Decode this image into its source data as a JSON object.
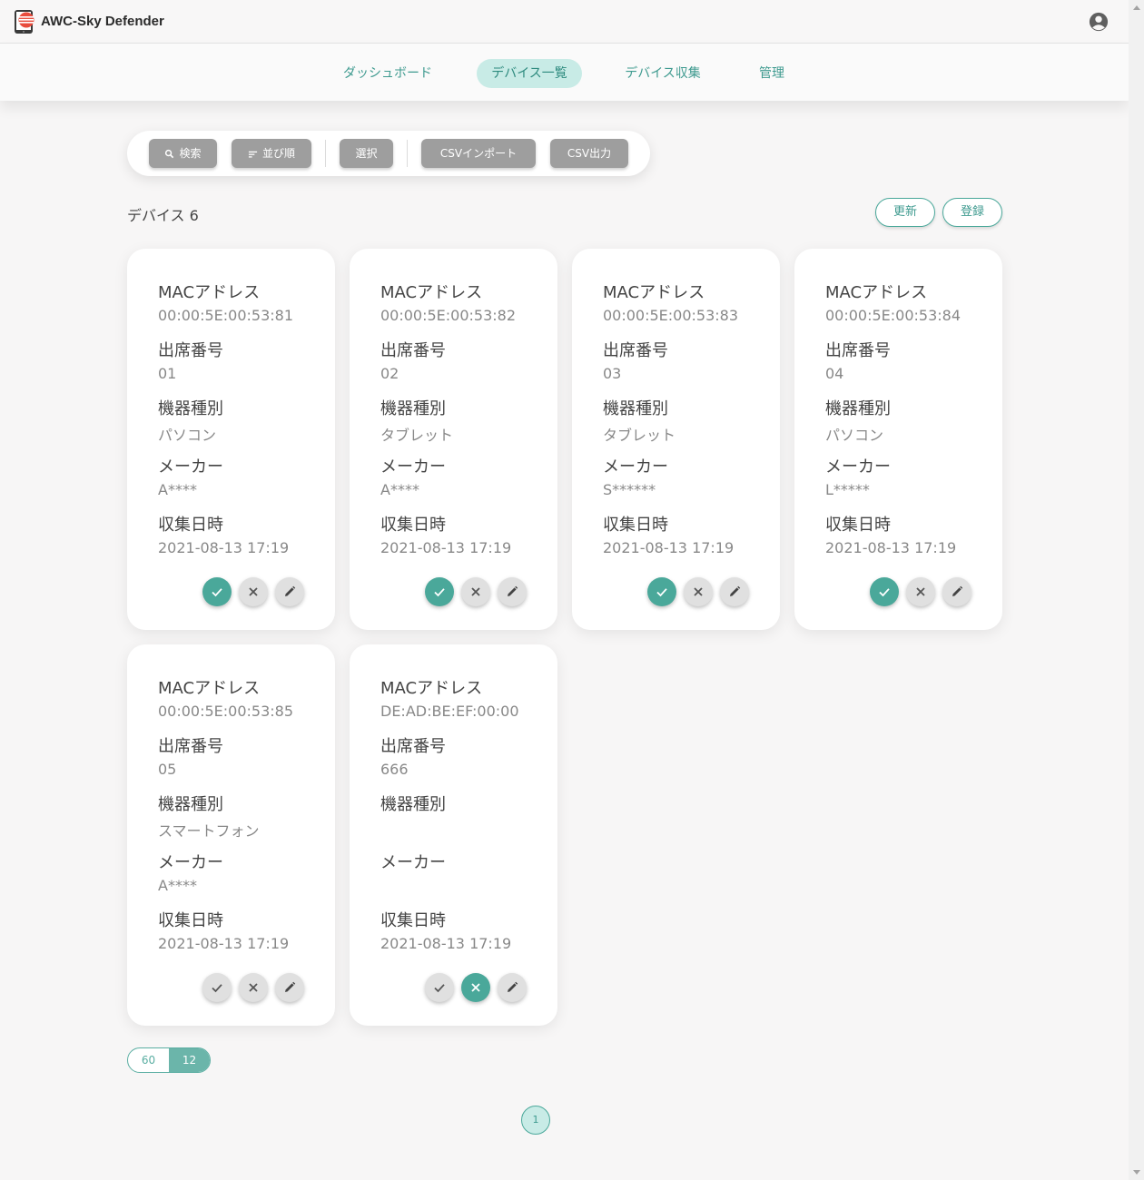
{
  "app": {
    "title": "AWC-Sky Defender",
    "accent_color": "#4aa89a",
    "logo_icon": "tablet-shield-icon",
    "account_icon": "account-circle-icon"
  },
  "nav": {
    "tabs": [
      {
        "label": "ダッシュボード",
        "active": false
      },
      {
        "label": "デバイス一覧",
        "active": true
      },
      {
        "label": "デバイス収集",
        "active": false
      },
      {
        "label": "管理",
        "active": false
      }
    ]
  },
  "toolbar": {
    "search_label": "検索",
    "sort_label": "並び順",
    "select_label": "選択",
    "csv_import_label": "CSVインポート",
    "csv_export_label": "CSV出力"
  },
  "list": {
    "count_label": "デバイス 6",
    "refresh_label": "更新",
    "register_label": "登録"
  },
  "labels": {
    "mac": "MACアドレス",
    "seat": "出席番号",
    "type": "機器種別",
    "maker": "メーカー",
    "collected": "収集日時"
  },
  "devices": [
    {
      "mac": "00:00:5E:00:53:81",
      "seat": "01",
      "type": "パソコン",
      "maker": "A****",
      "collected": "2021-08-13 17:19",
      "status": "approved"
    },
    {
      "mac": "00:00:5E:00:53:82",
      "seat": "02",
      "type": "タブレット",
      "maker": "A****",
      "collected": "2021-08-13 17:19",
      "status": "approved"
    },
    {
      "mac": "00:00:5E:00:53:83",
      "seat": "03",
      "type": "タブレット",
      "maker": "S******",
      "collected": "2021-08-13 17:19",
      "status": "approved"
    },
    {
      "mac": "00:00:5E:00:53:84",
      "seat": "04",
      "type": "パソコン",
      "maker": "L*****",
      "collected": "2021-08-13 17:19",
      "status": "approved"
    },
    {
      "mac": "00:00:5E:00:53:85",
      "seat": "05",
      "type": "スマートフォン",
      "maker": "A****",
      "collected": "2021-08-13 17:19",
      "status": "none"
    },
    {
      "mac": "DE:AD:BE:EF:00:00",
      "seat": "666",
      "type": "",
      "maker": "",
      "collected": "2021-08-13 17:19",
      "status": "rejected"
    }
  ],
  "pagination": {
    "per_page_options": [
      "60",
      "12"
    ],
    "per_page_selected": "12",
    "current_page": "1"
  }
}
